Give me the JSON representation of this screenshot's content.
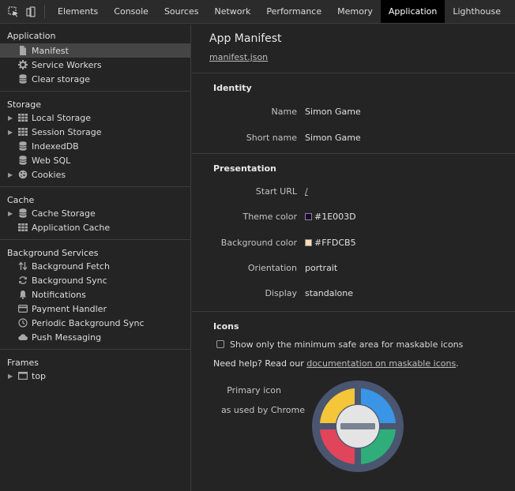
{
  "toolbar": {
    "icons": [
      "inspect-element-icon",
      "device-toolbar-icon"
    ],
    "tabs": [
      {
        "label": "Elements"
      },
      {
        "label": "Console"
      },
      {
        "label": "Sources"
      },
      {
        "label": "Network"
      },
      {
        "label": "Performance"
      },
      {
        "label": "Memory"
      },
      {
        "label": "Application",
        "active": true
      },
      {
        "label": "Lighthouse"
      }
    ]
  },
  "sidebar": {
    "application": {
      "title": "Application",
      "items": [
        {
          "label": "Manifest",
          "icon": "file-icon",
          "selected": true
        },
        {
          "label": "Service Workers",
          "icon": "gear-icon"
        },
        {
          "label": "Clear storage",
          "icon": "database-icon"
        }
      ]
    },
    "storage": {
      "title": "Storage",
      "items": [
        {
          "label": "Local Storage",
          "icon": "grid-icon",
          "expandable": true
        },
        {
          "label": "Session Storage",
          "icon": "grid-icon",
          "expandable": true
        },
        {
          "label": "IndexedDB",
          "icon": "database-icon"
        },
        {
          "label": "Web SQL",
          "icon": "database-icon"
        },
        {
          "label": "Cookies",
          "icon": "cookie-icon",
          "expandable": true
        }
      ]
    },
    "cache": {
      "title": "Cache",
      "items": [
        {
          "label": "Cache Storage",
          "icon": "database-icon",
          "expandable": true
        },
        {
          "label": "Application Cache",
          "icon": "grid-icon"
        }
      ]
    },
    "background": {
      "title": "Background Services",
      "items": [
        {
          "label": "Background Fetch",
          "icon": "arrows-updown-icon"
        },
        {
          "label": "Background Sync",
          "icon": "sync-icon"
        },
        {
          "label": "Notifications",
          "icon": "bell-icon"
        },
        {
          "label": "Payment Handler",
          "icon": "card-icon"
        },
        {
          "label": "Periodic Background Sync",
          "icon": "clock-icon"
        },
        {
          "label": "Push Messaging",
          "icon": "cloud-icon"
        }
      ]
    },
    "frames": {
      "title": "Frames",
      "items": [
        {
          "label": "top",
          "icon": "frame-icon",
          "expandable": true
        }
      ]
    }
  },
  "main": {
    "title": "App Manifest",
    "manifest_link": "manifest.json",
    "identity": {
      "title": "Identity",
      "name_label": "Name",
      "name_value": "Simon Game",
      "short_name_label": "Short name",
      "short_name_value": "Simon Game"
    },
    "presentation": {
      "title": "Presentation",
      "start_url_label": "Start URL",
      "start_url_value": "/",
      "theme_color_label": "Theme color",
      "theme_color_value": "#1E003D",
      "background_color_label": "Background color",
      "background_color_value": "#FFDCB5",
      "orientation_label": "Orientation",
      "orientation_value": "portrait",
      "display_label": "Display",
      "display_value": "standalone"
    },
    "icons": {
      "title": "Icons",
      "checkbox_label": "Show only the minimum safe area for maskable icons",
      "help_prefix": "Need help? Read our ",
      "help_link": "documentation on maskable icons",
      "help_suffix": ".",
      "primary_label": "Primary icon",
      "primary_sublabel": "as used by Chrome",
      "icon_colors": {
        "ring": "#4a5670",
        "yellow": "#f5c53a",
        "blue": "#3b95e6",
        "red": "#e0455a",
        "green": "#2fae7a",
        "center": "#e4e4e4",
        "bar": "#7a8394"
      }
    }
  }
}
